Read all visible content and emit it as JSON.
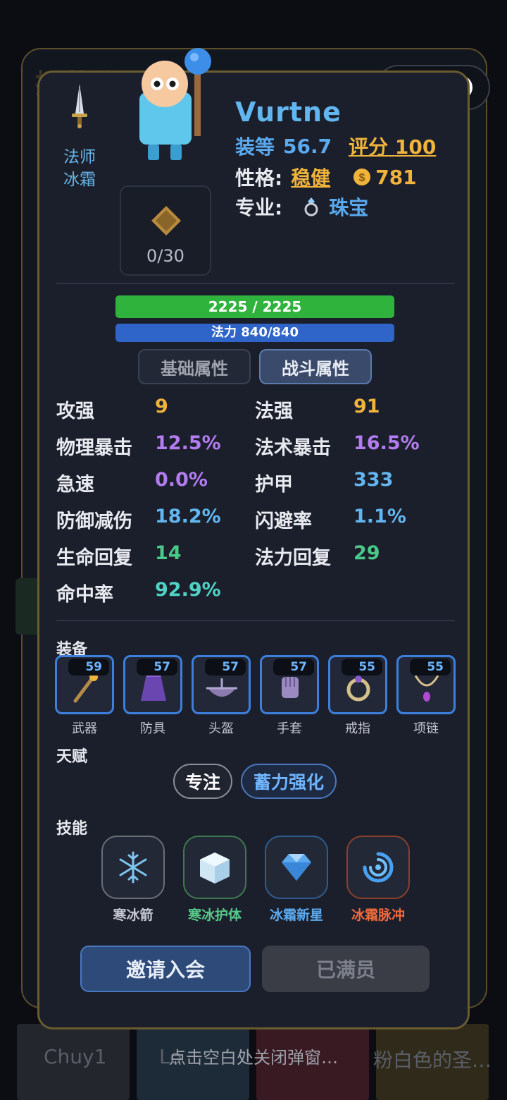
{
  "background": {
    "title": "招募伙伴",
    "cards": [
      "Chuy1",
      "Lo",
      "",
      "粉白色的圣…"
    ]
  },
  "capsule": {
    "more_icon": "more-dots-icon",
    "close_icon": "target-close-icon"
  },
  "character": {
    "weapon_icon": "dagger-icon",
    "class": "法师",
    "spec": "冰霜",
    "portrait_count": "0/30",
    "name": "Vurtne",
    "gear_score_label": "装等",
    "gear_score": "56.7",
    "rating_label": "评分",
    "rating": "100",
    "personality_label": "性格:",
    "personality": "稳健",
    "gold": "781",
    "profession_label": "专业:",
    "profession": "珠宝"
  },
  "bars": {
    "hp_text": "2225 / 2225",
    "hp_fraction": 1.0,
    "mana_text": "法力 840/840",
    "mana_fraction": 1.0
  },
  "tabs": [
    {
      "label": "基础属性",
      "active": false
    },
    {
      "label": "战斗属性",
      "active": true
    }
  ],
  "stats": {
    "left": [
      {
        "label": "攻强",
        "value": "9",
        "color": "#f0b43c"
      },
      {
        "label": "物理暴击",
        "value": "12.5%",
        "color": "#b27cf0"
      },
      {
        "label": "急速",
        "value": "0.0%",
        "color": "#b27cf0"
      },
      {
        "label": "防御减伤",
        "value": "18.2%",
        "color": "#62b6ef"
      },
      {
        "label": "生命回复",
        "value": "14",
        "color": "#49c98a"
      },
      {
        "label": "命中率",
        "value": "92.9%",
        "color": "#4fd1c5"
      }
    ],
    "right": [
      {
        "label": "法强",
        "value": "91",
        "color": "#f0b43c"
      },
      {
        "label": "法术暴击",
        "value": "16.5%",
        "color": "#b27cf0"
      },
      {
        "label": "护甲",
        "value": "333",
        "color": "#62b6ef"
      },
      {
        "label": "闪避率",
        "value": "1.1%",
        "color": "#62b6ef"
      },
      {
        "label": "法力回复",
        "value": "29",
        "color": "#49c98a"
      }
    ]
  },
  "equipment": {
    "title": "装备",
    "slots": [
      {
        "label": "武器",
        "level": "59",
        "icon": "wand-icon"
      },
      {
        "label": "防具",
        "level": "57",
        "icon": "robe-icon"
      },
      {
        "label": "头盔",
        "level": "57",
        "icon": "helmet-icon"
      },
      {
        "label": "手套",
        "level": "57",
        "icon": "glove-icon"
      },
      {
        "label": "戒指",
        "level": "55",
        "icon": "ring-icon"
      },
      {
        "label": "项链",
        "level": "55",
        "icon": "necklace-icon"
      }
    ]
  },
  "talents": {
    "title": "天赋",
    "items": [
      "专注",
      "蓄力强化"
    ]
  },
  "skills": {
    "title": "技能",
    "items": [
      {
        "label": "寒冰箭",
        "icon": "snowflake-icon",
        "color": "#c4c7d0"
      },
      {
        "label": "寒冰护体",
        "icon": "ice-block-icon",
        "color": "#58c98a"
      },
      {
        "label": "冰霜新星",
        "icon": "diamond-icon",
        "color": "#5aa9ef"
      },
      {
        "label": "冰霜脉冲",
        "icon": "vortex-icon",
        "color": "#ef6a3c"
      }
    ]
  },
  "buttons": {
    "invite": "邀请入会",
    "full": "已满员"
  },
  "close_hint": "点击空白处关闭弹窗…"
}
